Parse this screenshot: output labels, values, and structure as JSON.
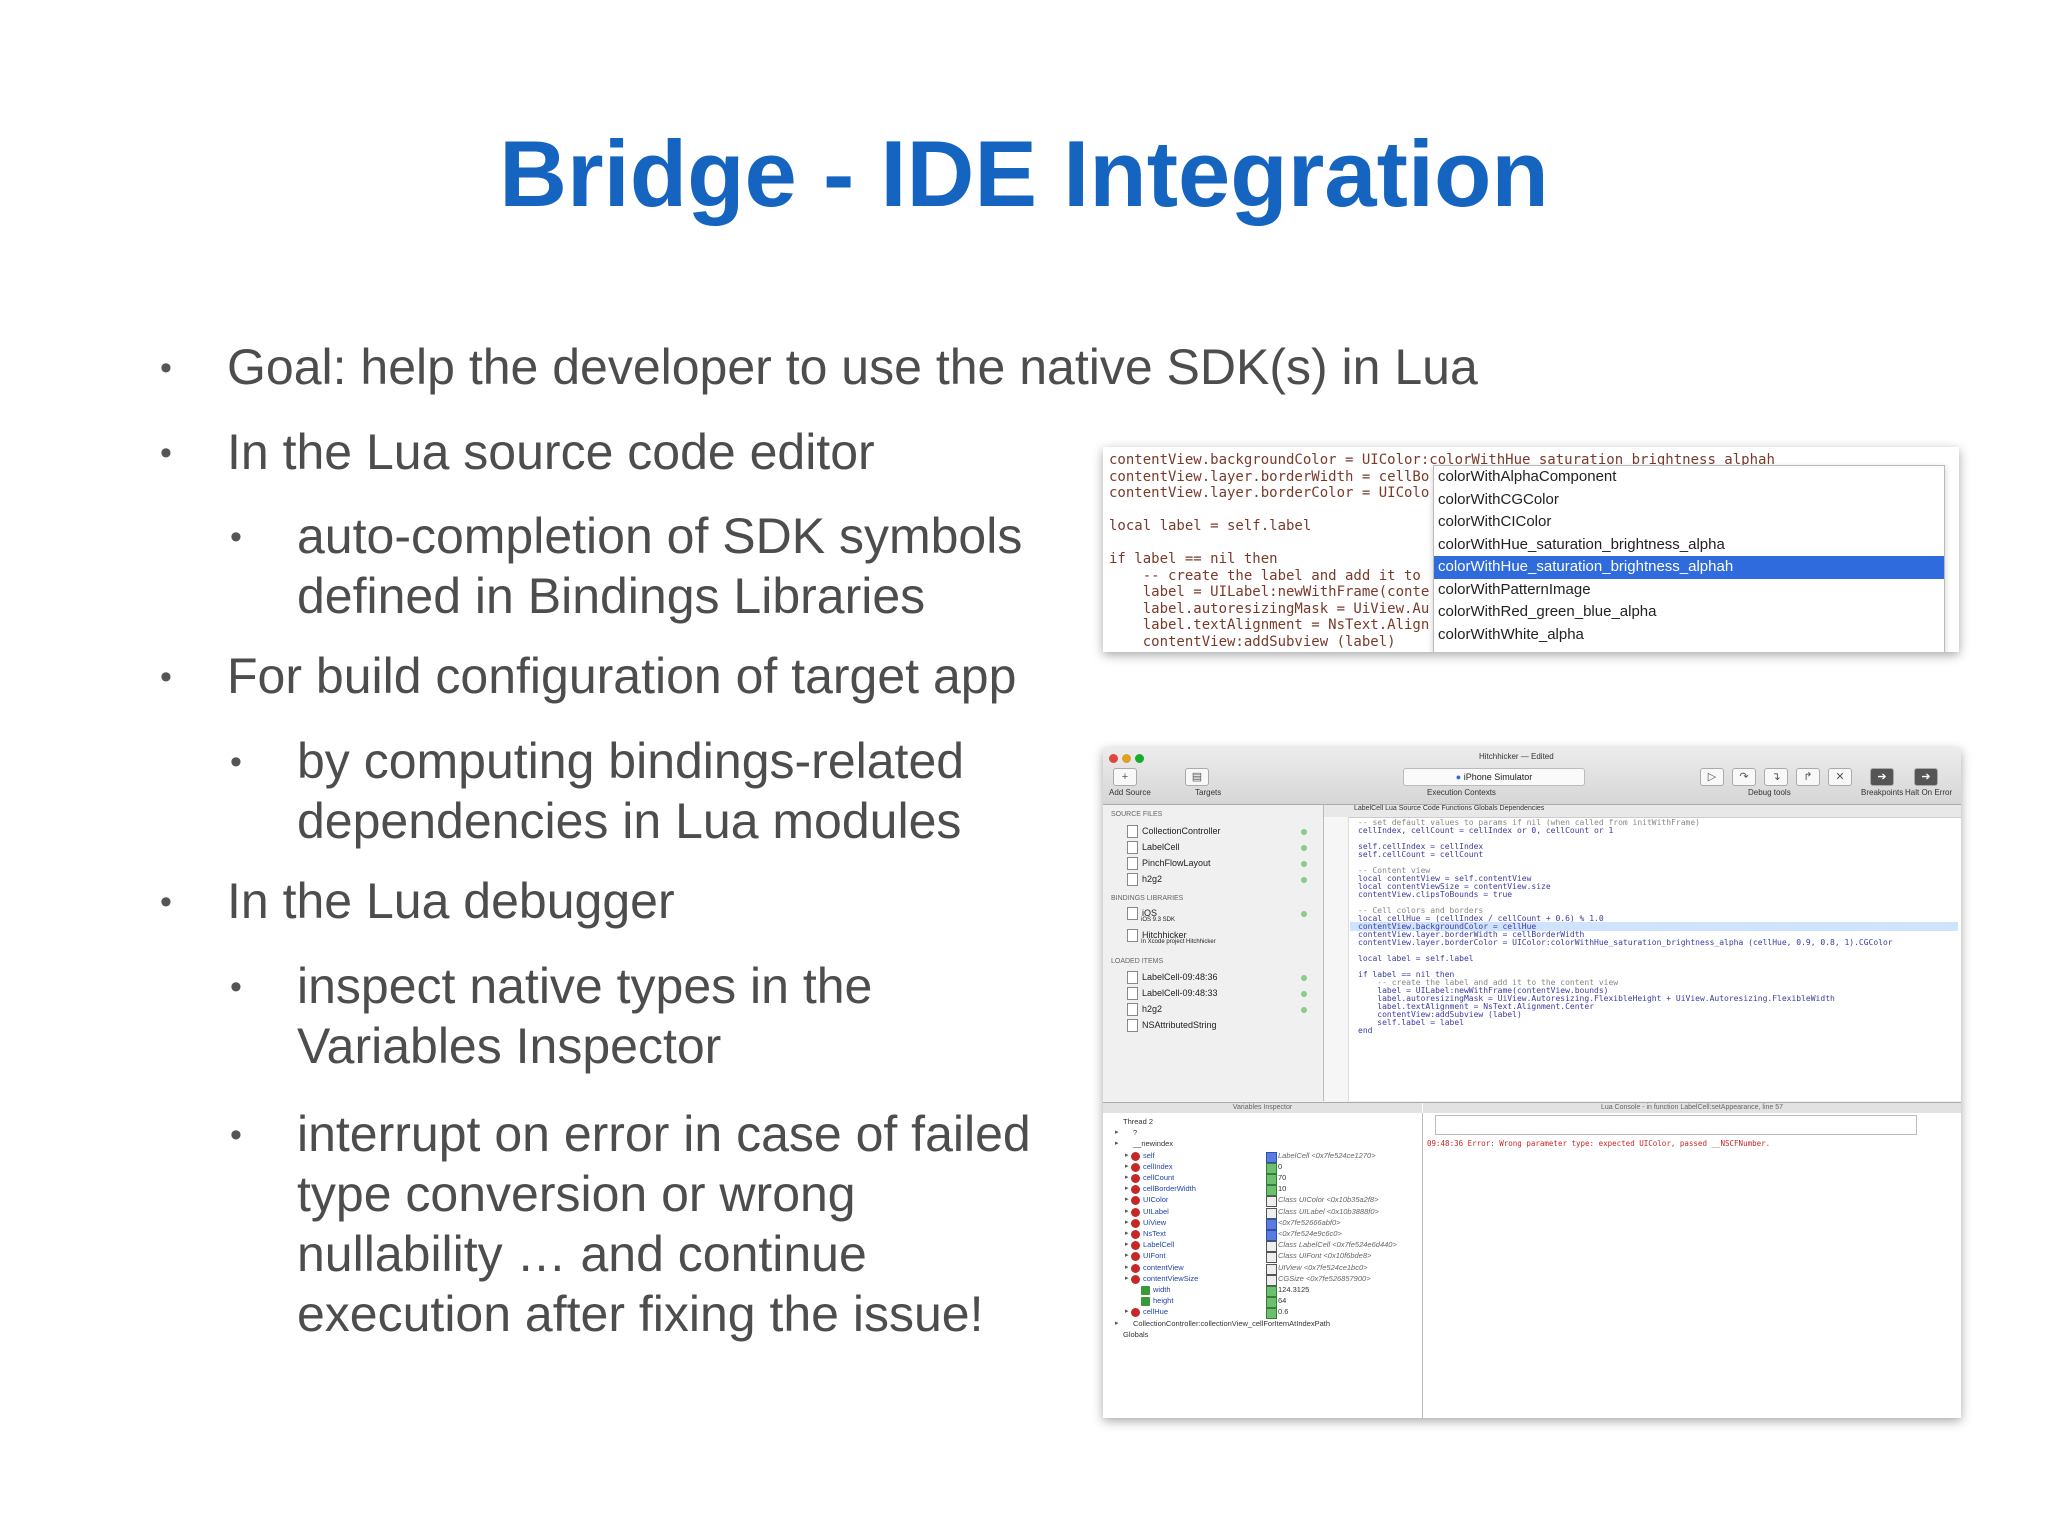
{
  "slide": {
    "title": "Bridge - IDE Integration",
    "bullets": [
      {
        "level": 1,
        "text": "Goal: help the developer to use the native SDK(s) in Lua"
      },
      {
        "level": 1,
        "text": "In the Lua source code editor"
      },
      {
        "level": 2,
        "lines": [
          "auto-completion of SDK symbols",
          "defined in Bindings Libraries"
        ]
      },
      {
        "level": 1,
        "text": "For build configuration of target app"
      },
      {
        "level": 2,
        "lines": [
          "by computing bindings-related",
          "dependencies in Lua modules"
        ]
      },
      {
        "level": 1,
        "text": "In the Lua debugger"
      },
      {
        "level": 2,
        "lines": [
          "inspect native types in the",
          "Variables Inspector"
        ]
      },
      {
        "level": 2,
        "lines": [
          "interrupt on error in case of failed",
          "type conversion or wrong",
          "nullability … and continue",
          "execution after fixing the issue!"
        ]
      }
    ],
    "bullet_glyph": "•",
    "title_color": "#1565c0"
  },
  "autocomplete": {
    "code_lines": [
      "contentView.backgroundColor = UIColor:colorWithHue_saturation_brightness_alphah",
      "contentView.layer.borderWidth = cellBo",
      "contentView.layer.borderColor = UIColo",
      "",
      "local label = self.label",
      "",
      "if label == nil then",
      "    -- create the label and add it to",
      "    label = UILabel:newWithFrame(conte",
      "    label.autoresizingMask = UiView.Au",
      "    label.textAlignment = NsText.Align",
      "    contentView:addSubview (label)"
    ],
    "items": [
      "colorWithAlphaComponent",
      "colorWithCGColor",
      "colorWithCIColor",
      "colorWithHue_saturation_brightness_alpha",
      "colorWithHue_saturation_brightness_alphah",
      "colorWithPatternImage",
      "colorWithRed_green_blue_alpha",
      "colorWithWhite_alpha"
    ],
    "selected_index": 4
  },
  "ide": {
    "window_title": "Hitchhicker — Edited",
    "scheme": "iPhone Simulator",
    "toolbar_labels": {
      "add_source": "Add Source",
      "targets": "Targets",
      "execution_contexts": "Execution Contexts",
      "debug_tools": "Debug tools",
      "breakpoints": "Breakpoints",
      "halt_on_error": "Halt On Error"
    },
    "sections": {
      "source_files": "SOURCE FILES",
      "bindings_libraries": "BINDINGS LIBRARIES",
      "loaded_items": "LOADED ITEMS"
    },
    "source_files": [
      "CollectionController",
      "LabelCell",
      "PinchFlowLayout",
      "h2g2"
    ],
    "bindings": [
      {
        "name": "iOS",
        "sub": "iOS 9.3 SDK"
      },
      {
        "name": "Hitchhicker",
        "sub": "In Xcode project Hitchhicker"
      }
    ],
    "loaded_items": [
      "LabelCell-09:48:36",
      "LabelCell-09:48:33",
      "h2g2",
      "NSAttributedString"
    ],
    "tabbar": "LabelCell    Lua Source Code    Functions    Globals    Dependencies",
    "code_lines": [
      {
        "t": "-- set default values to params if nil (when called from initWithFrame)",
        "c": "cm"
      },
      {
        "t": "cellIndex, cellCount = cellIndex or 0, cellCount or 1",
        "c": ""
      },
      {
        "t": "",
        "c": ""
      },
      {
        "t": "self.cellIndex = cellIndex",
        "c": ""
      },
      {
        "t": "self.cellCount = cellCount",
        "c": ""
      },
      {
        "t": "",
        "c": ""
      },
      {
        "t": "-- Content view",
        "c": "cm"
      },
      {
        "t": "local contentView = self.contentView",
        "c": ""
      },
      {
        "t": "local contentViewSize = contentView.size",
        "c": ""
      },
      {
        "t": "contentView.clipsToBounds = true",
        "c": ""
      },
      {
        "t": "",
        "c": ""
      },
      {
        "t": "-- Cell colors and borders",
        "c": "cm"
      },
      {
        "t": "local cellHue = (cellIndex / cellCount + 0.6) % 1.0",
        "c": ""
      },
      {
        "t": "contentView.backgroundColor = cellHue",
        "c": "hl"
      },
      {
        "t": "contentView.layer.borderWidth = cellBorderWidth",
        "c": ""
      },
      {
        "t": "contentView.layer.borderColor = UIColor:colorWithHue_saturation_brightness_alpha (cellHue, 0.9, 0.8, 1).CGColor",
        "c": ""
      },
      {
        "t": "",
        "c": ""
      },
      {
        "t": "local label = self.label",
        "c": ""
      },
      {
        "t": "",
        "c": ""
      },
      {
        "t": "if label == nil then",
        "c": ""
      },
      {
        "t": "    -- create the label and add it to the content view",
        "c": "cm"
      },
      {
        "t": "    label = UILabel:newWithFrame(contentView.bounds)",
        "c": ""
      },
      {
        "t": "    label.autoresizingMask = UiView.Autoresizing.FlexibleHeight + UiView.Autoresizing.FlexibleWidth",
        "c": ""
      },
      {
        "t": "    label.textAlignment = NsText.Alignment.Center",
        "c": ""
      },
      {
        "t": "    contentView:addSubview (label)",
        "c": ""
      },
      {
        "t": "    self.label = label",
        "c": ""
      },
      {
        "t": "end",
        "c": ""
      }
    ],
    "variables_header": "Variables Inspector",
    "console_header": "Lua Console - in function LabelCell:setAppearance, line 57",
    "console_error": "09:48:36 Error: Wrong parameter type: expected UIColor, passed __NSCFNumber.",
    "variables": [
      {
        "name": "Thread 2",
        "value": "",
        "icon": "none",
        "vt": "none",
        "indent": 0
      },
      {
        "name": "?",
        "value": "",
        "icon": "none",
        "vt": "none",
        "indent": 1
      },
      {
        "name": "__newindex",
        "value": "",
        "icon": "none",
        "vt": "none",
        "indent": 1
      },
      {
        "name": "self",
        "value": "LabelCell <0x7fe524ce1270>",
        "icon": "r",
        "vt": "b",
        "indent": 2,
        "it": true
      },
      {
        "name": "cellIndex",
        "value": "0",
        "icon": "r",
        "vt": "g",
        "indent": 2
      },
      {
        "name": "cellCount",
        "value": "70",
        "icon": "r",
        "vt": "g",
        "indent": 2
      },
      {
        "name": "cellBorderWidth",
        "value": "10",
        "icon": "r",
        "vt": "g",
        "indent": 2
      },
      {
        "name": "UIColor",
        "value": "Class UIColor <0x10b35a2f8>",
        "icon": "r",
        "vt": "w",
        "indent": 2,
        "it": true
      },
      {
        "name": "UILabel",
        "value": "Class UILabel <0x10b3888f0>",
        "icon": "r",
        "vt": "w",
        "indent": 2,
        "it": true
      },
      {
        "name": "UiView",
        "value": "<0x7fe52666abf0>",
        "icon": "r",
        "vt": "b",
        "indent": 2,
        "it": true
      },
      {
        "name": "NsText",
        "value": "<0x7fe524e9c6c0>",
        "icon": "r",
        "vt": "b",
        "indent": 2,
        "it": true
      },
      {
        "name": "LabelCell",
        "value": "Class LabelCell <0x7fe524e6d440>",
        "icon": "r",
        "vt": "w",
        "indent": 2,
        "it": true
      },
      {
        "name": "UIFont",
        "value": "Class UIFont <0x10f6bde8>",
        "icon": "r",
        "vt": "w",
        "indent": 2,
        "it": true
      },
      {
        "name": "contentView",
        "value": "UIView <0x7fe524ce1bc0>",
        "icon": "r",
        "vt": "w",
        "indent": 2,
        "it": true
      },
      {
        "name": "contentViewSize",
        "value": "CGSize <0x7fe526857900>",
        "icon": "r",
        "vt": "w",
        "indent": 2,
        "it": true
      },
      {
        "name": "width",
        "value": "124.3125",
        "icon": "g",
        "vt": "g",
        "indent": 3
      },
      {
        "name": "height",
        "value": "64",
        "icon": "g",
        "vt": "g",
        "indent": 3
      },
      {
        "name": "cellHue",
        "value": "0.6",
        "icon": "r",
        "vt": "g",
        "indent": 2
      },
      {
        "name": "CollectionController:collectionView_cellForItemAtIndexPath",
        "value": "",
        "icon": "none",
        "vt": "none",
        "indent": 1
      },
      {
        "name": "Globals",
        "value": "",
        "icon": "none",
        "vt": "none",
        "indent": 0
      }
    ]
  }
}
